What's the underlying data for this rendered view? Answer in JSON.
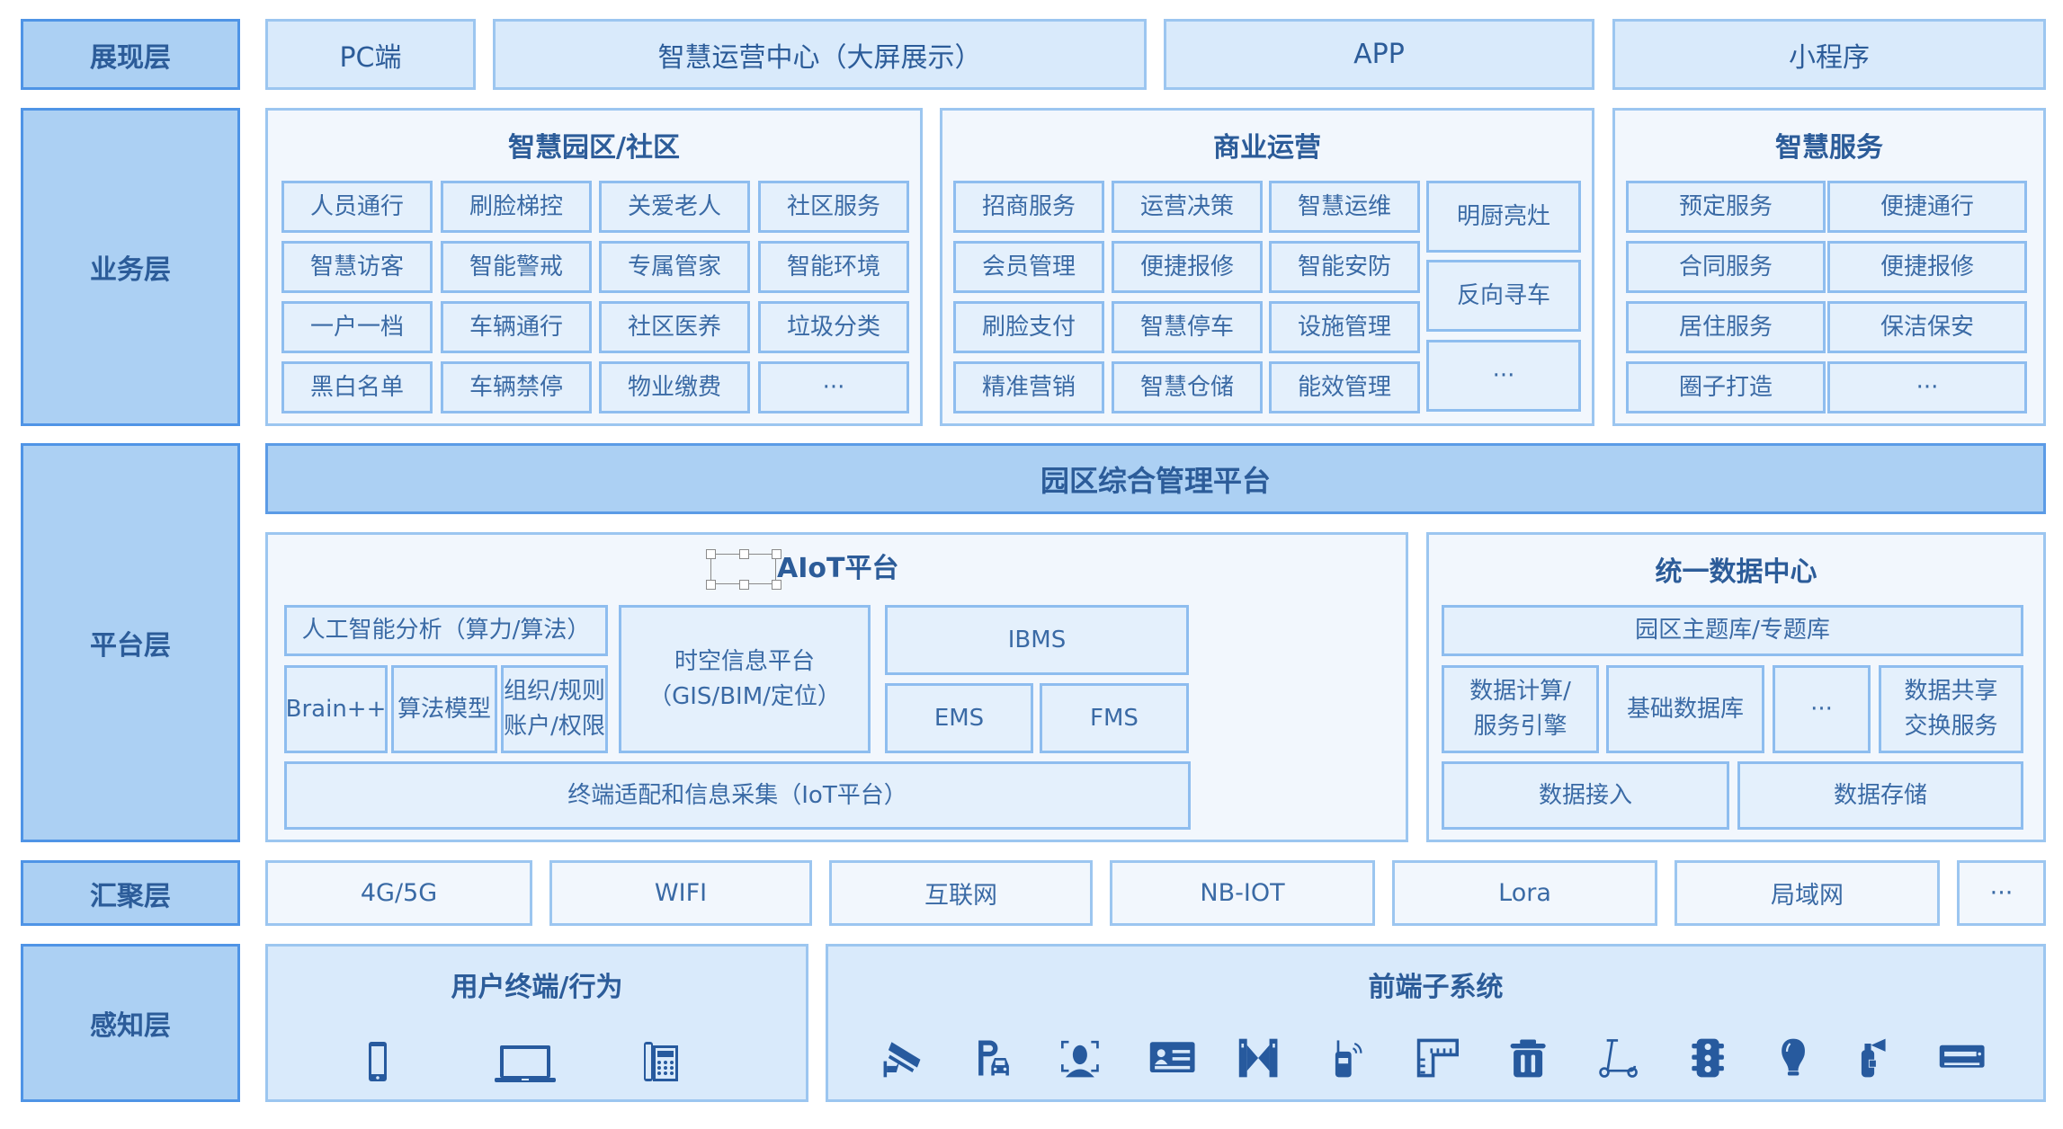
{
  "layers": {
    "presentation": "展现层",
    "business": "业务层",
    "platform": "平台层",
    "aggregation": "汇聚层",
    "perception": "感知层"
  },
  "presentation": [
    "PC端",
    "智慧运营中心（大屏展示）",
    "APP",
    "小程序"
  ],
  "business": {
    "park": {
      "title": "智慧园区/社区",
      "items": [
        "人员通行",
        "刷脸梯控",
        "关爱老人",
        "社区服务",
        "智慧访客",
        "智能警戒",
        "专属管家",
        "智能环境",
        "一户一档",
        "车辆通行",
        "社区医养",
        "垃圾分类",
        "黑白名单",
        "车辆禁停",
        "物业缴费",
        "···"
      ]
    },
    "commerce": {
      "title": "商业运营",
      "items": [
        "招商服务",
        "运营决策",
        "智慧运维",
        "会员管理",
        "便捷报修",
        "智能安防",
        "刷脸支付",
        "智慧停车",
        "设施管理",
        "精准营销",
        "智慧仓储",
        "能效管理"
      ],
      "side_items": [
        "明厨亮灶",
        "反向寻车",
        "···"
      ]
    },
    "services": {
      "title": "智慧服务",
      "items": [
        "预定服务",
        "便捷通行",
        "合同服务",
        "便捷报修",
        "居住服务",
        "保洁保安",
        "圈子打造",
        "···"
      ]
    }
  },
  "platform": {
    "bar": "园区综合管理平台",
    "aiot": {
      "title": "AIoT平台",
      "ai_analysis": "人工智能分析（算力/算法）",
      "brain": "Brain++",
      "algo": "算法模型",
      "org_line1": "组织/规则",
      "org_line2": "账户/权限",
      "spatial_line1": "时空信息平台",
      "spatial_line2": "（GIS/BIM/定位）",
      "ibms": "IBMS",
      "ems": "EMS",
      "fms": "FMS",
      "iot": "终端适配和信息采集（IoT平台）"
    },
    "data_center": {
      "title": "统一数据中心",
      "theme_db": "园区主题库/专题库",
      "compute_line1": "数据计算/",
      "compute_line2": "服务引擎",
      "base_db": "基础数据库",
      "more": "···",
      "share_line1": "数据共享",
      "share_line2": "交换服务",
      "ingest": "数据接入",
      "storage": "数据存储"
    }
  },
  "aggregation": [
    "4G/5G",
    "WIFI",
    "互联网",
    "NB-IOT",
    "Lora",
    "局域网",
    "···"
  ],
  "perception": {
    "user_title": "用户终端/行为",
    "user_icons": [
      "mobile-phone",
      "laptop",
      "desk-phone"
    ],
    "front_title": "前端子系统",
    "front_icons": [
      "surveillance-camera",
      "parking",
      "face-recognition",
      "id-card",
      "turnstile-gate",
      "walkie-talkie",
      "building-ruler",
      "trash-bin",
      "scooter",
      "traffic-light",
      "light-bulb",
      "fire-extinguisher",
      "air-conditioner"
    ]
  },
  "colors": {
    "label_bg": "#acd0f3",
    "label_border": "#4f94e6",
    "cell_bg": "#e4f0fc",
    "panel_bg": "#f2f7fd",
    "text": "#2c5c99",
    "icon": "#275a9e"
  }
}
